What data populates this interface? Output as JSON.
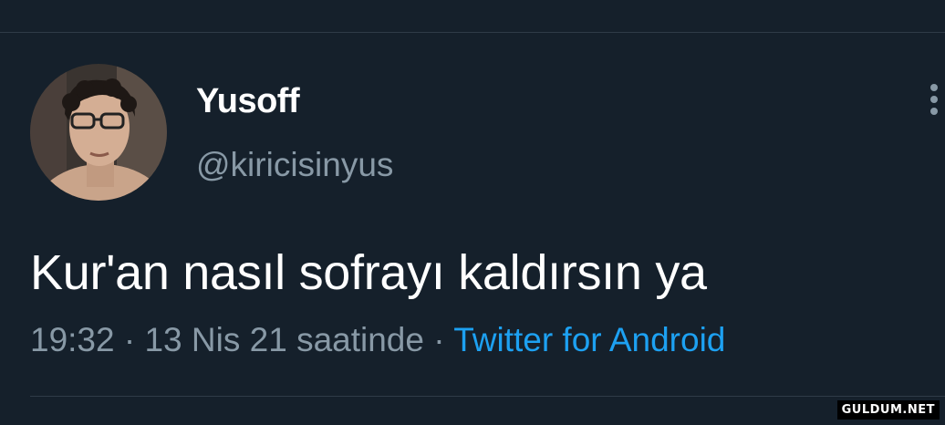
{
  "tweet": {
    "display_name": "Yusoff",
    "handle": "@kiricisinyus",
    "text": "Kur'an nasıl sofrayı kaldırsın ya",
    "time": "19:32",
    "separator": " · ",
    "date": "13 Nis 21 saatinde",
    "source": "Twitter for Android"
  },
  "icons": {
    "more": "more-vertical-icon",
    "avatar": "profile-photo"
  },
  "colors": {
    "background": "#15202b",
    "primary_text": "#ffffff",
    "secondary_text": "#8899a6",
    "link": "#1da1f2",
    "divider": "#2f3b47"
  },
  "watermark": {
    "text": "GULDUM.NET"
  }
}
